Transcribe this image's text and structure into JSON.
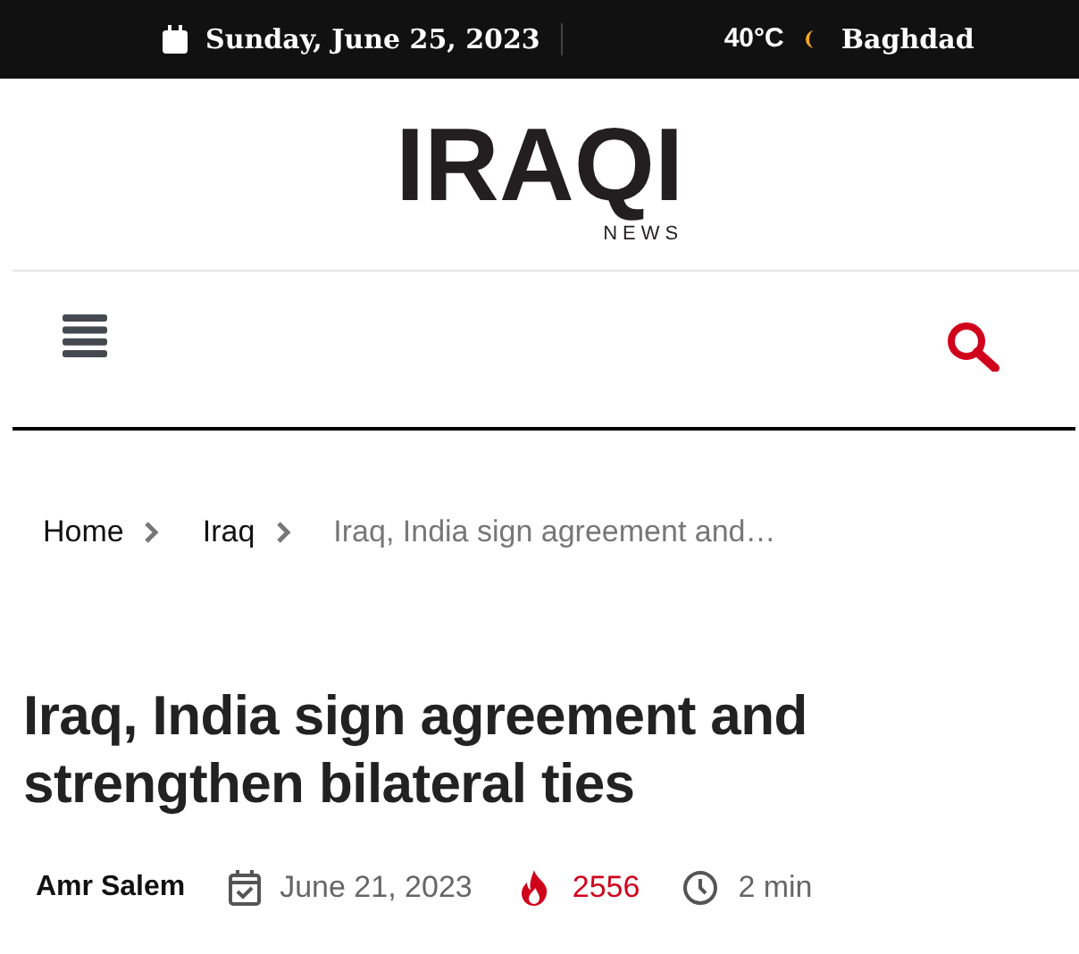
{
  "top_bar": {
    "date": "Sunday, June 25, 2023",
    "temperature": "40°C",
    "city": "Baghdad"
  },
  "logo": {
    "name": "IRAQI",
    "tagline": "NEWS"
  },
  "breadcrumb": [
    {
      "label": "Home",
      "current": false
    },
    {
      "label": "Iraq",
      "current": false
    },
    {
      "label": "Iraq, India sign agreement and…",
      "current": true
    }
  ],
  "article": {
    "title": "Iraq, India sign agreement and strengthen bilateral ties",
    "author": "Amr Salem",
    "date": "June 21, 2023",
    "views": "2556",
    "read_time": "2 min"
  }
}
